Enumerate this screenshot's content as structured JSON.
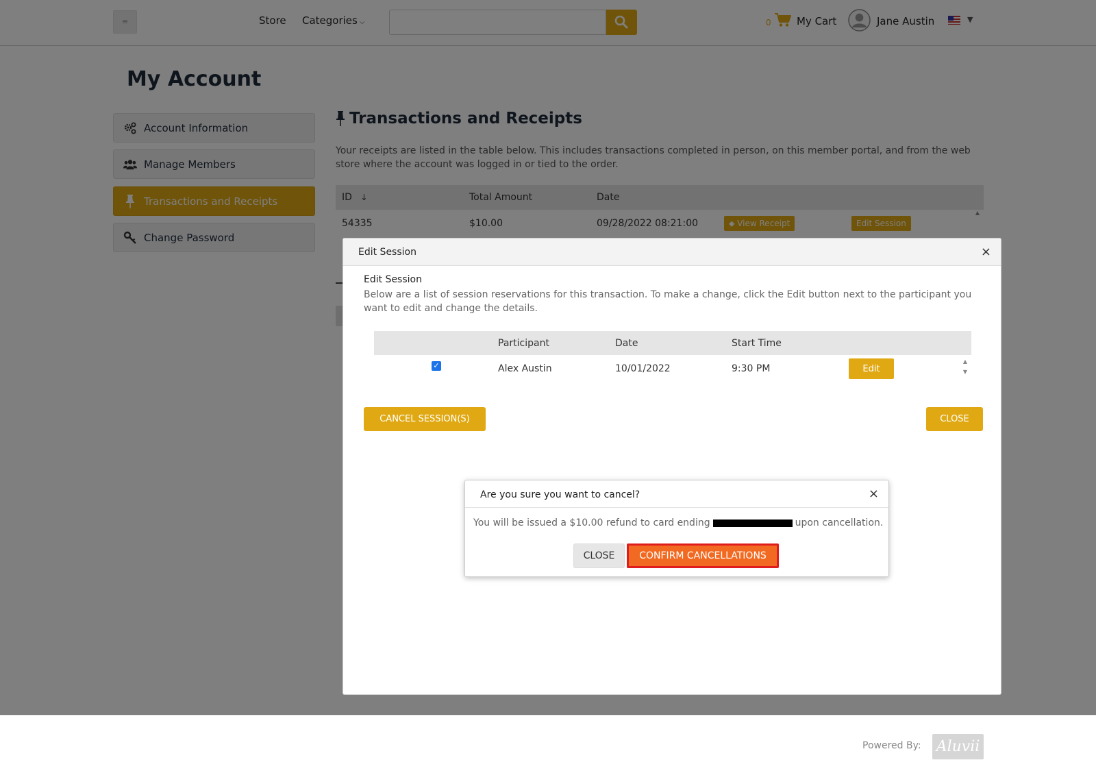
{
  "header": {
    "menu_icon": "≡",
    "nav": {
      "store": "Store",
      "categories": "Categories"
    },
    "search": {
      "placeholder": ""
    },
    "cart": {
      "count": "0",
      "label": "My Cart"
    },
    "user": {
      "name": "Jane Austin"
    }
  },
  "page": {
    "title": "My Account"
  },
  "sidebar": {
    "items": [
      {
        "label": "Account Information",
        "icon": "gears-icon"
      },
      {
        "label": "Manage Members",
        "icon": "users-icon"
      },
      {
        "label": "Transactions and Receipts",
        "icon": "pin-icon",
        "active": true
      },
      {
        "label": "Change Password",
        "icon": "key-icon"
      }
    ]
  },
  "transactions": {
    "title": "Transactions and Receipts",
    "description": "Your receipts are listed in the table below. This includes transactions completed in person, on this member portal, and from the web store where the account was logged in or tied to the order.",
    "columns": {
      "id": "ID",
      "sort": "↓",
      "amount": "Total Amount",
      "date": "Date"
    },
    "rows": [
      {
        "id": "54335",
        "amount": "$10.00",
        "date": "09/28/2022 08:21:00",
        "view_receipt": "View Receipt",
        "edit_session": "Edit Session"
      }
    ]
  },
  "edit_session_modal": {
    "title": "Edit Session",
    "subtitle": "Edit Session",
    "description": "Below are a list of session reservations for this transaction. To make a change, click the Edit button next to the participant you want to edit and change the details.",
    "columns": {
      "participant": "Participant",
      "date": "Date",
      "start_time": "Start Time"
    },
    "rows": [
      {
        "checked": true,
        "participant": "Alex Austin",
        "date": "10/01/2022",
        "start_time": "9:30 PM",
        "edit": "Edit"
      }
    ],
    "cancel_sessions": "CANCEL SESSION(S)",
    "close": "CLOSE"
  },
  "confirm_dialog": {
    "title": "Are you sure you want to cancel?",
    "message_before": "You will be issued a $10.00 refund to card ending",
    "message_after": "upon cancellation.",
    "close": "CLOSE",
    "confirm": "CONFIRM CANCELLATIONS"
  },
  "footer": {
    "powered_by": "Powered By:",
    "logo_text": "Aluvii"
  },
  "colors": {
    "accent": "#e0a913",
    "confirm": "#f26a21",
    "highlight": "#e01d1d"
  }
}
